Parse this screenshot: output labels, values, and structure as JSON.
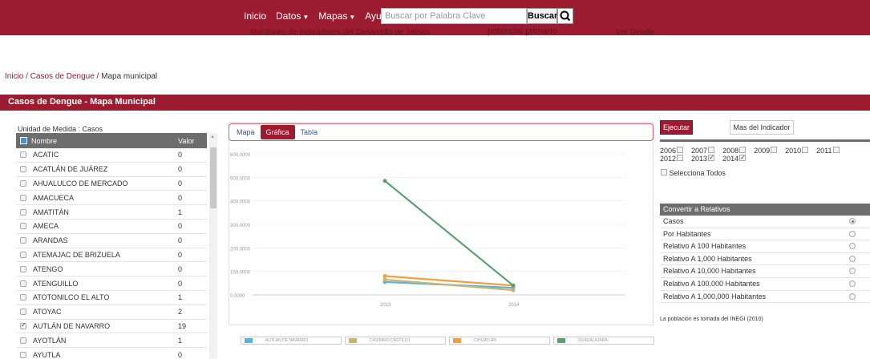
{
  "nav": {
    "inicio": "Inicio",
    "datos": "Datos",
    "mapas": "Mapas",
    "ayuda": "Ayuda",
    "search_placeholder": "Buscar por Palabra Clave",
    "buscar": "Buscar",
    "ghost_left": "Monitoreo de Indicadores del Desarrollo de Jalisco",
    "ghost_mid": "potencial primario",
    "ghost_right": "Ver Detalle"
  },
  "breadcrumb": {
    "home": "Inicio",
    "sep": " / ",
    "section": "Casos de Dengue",
    "current": "Mapa municipal"
  },
  "section_title": "Casos de Dengue - Mapa Municipal",
  "table": {
    "unit_label": "Unidad de Medida : Casos",
    "col_name": "Nombre",
    "col_value": "Valor",
    "rows": [
      {
        "name": "ACATIC",
        "value": "0",
        "checked": false
      },
      {
        "name": "ACATLÁN DE JUÁREZ",
        "value": "0",
        "checked": false
      },
      {
        "name": "AHUALULCO DE MERCADO",
        "value": "0",
        "checked": false
      },
      {
        "name": "AMACUECA",
        "value": "0",
        "checked": false
      },
      {
        "name": "AMATITÁN",
        "value": "1",
        "checked": false
      },
      {
        "name": "AMECA",
        "value": "0",
        "checked": false
      },
      {
        "name": "ARANDAS",
        "value": "0",
        "checked": false
      },
      {
        "name": "ATEMAJAC DE BRIZUELA",
        "value": "0",
        "checked": false
      },
      {
        "name": "ATENGO",
        "value": "0",
        "checked": false
      },
      {
        "name": "ATENGUILLO",
        "value": "0",
        "checked": false
      },
      {
        "name": "ATOTONILCO EL ALTO",
        "value": "1",
        "checked": false
      },
      {
        "name": "ATOYAC",
        "value": "2",
        "checked": false
      },
      {
        "name": "AUTLÁN DE NAVARRO",
        "value": "19",
        "checked": true
      },
      {
        "name": "AYOTLÁN",
        "value": "1",
        "checked": false
      },
      {
        "name": "AYUTLA",
        "value": "0",
        "checked": false
      }
    ]
  },
  "tabs": {
    "mapa": "Mapa",
    "grafica": "Gráfica",
    "tabla": "Tabla"
  },
  "chart_data": {
    "type": "line",
    "x": [
      "2013",
      "2014"
    ],
    "ylim": [
      0,
      600
    ],
    "yticks": [
      "0.0000",
      "100.0000",
      "200.0000",
      "300.0000",
      "400.0000",
      "500.0000",
      "600.0000"
    ],
    "series": [
      {
        "name": "AUTLÁN DE NAVARRO",
        "color": "#5ab4d6",
        "values": [
          55,
          30
        ]
      },
      {
        "name": "CASIMIRO CASTILLO",
        "color": "#c9b27a",
        "values": [
          65,
          20
        ]
      },
      {
        "name": "CIHUATLÁN",
        "color": "#f0a040",
        "values": [
          80,
          40
        ]
      },
      {
        "name": "GUADALAJARA",
        "color": "#5aa070",
        "values": [
          485,
          40
        ]
      }
    ]
  },
  "right": {
    "ejecutar": "Ejecutar",
    "mas": "Mas del Indicador",
    "years": [
      {
        "label": "2006",
        "checked": false
      },
      {
        "label": "2007",
        "checked": false
      },
      {
        "label": "2008",
        "checked": false
      },
      {
        "label": "2009",
        "checked": false
      },
      {
        "label": "2010",
        "checked": false
      },
      {
        "label": "2011",
        "checked": false
      },
      {
        "label": "2012",
        "checked": false
      },
      {
        "label": "2013",
        "checked": true
      },
      {
        "label": "2014",
        "checked": true
      }
    ],
    "select_all": "Selecciona Todos",
    "convert_title": "Convertir a Relativos",
    "options": [
      {
        "label": "Casos",
        "selected": true
      },
      {
        "label": "Por Habitantes",
        "selected": false
      },
      {
        "label": "Relativo A 100 Habitantes",
        "selected": false
      },
      {
        "label": "Relativo A 1,000 Habitantes",
        "selected": false
      },
      {
        "label": "Relativo A 10,000 Habitantes",
        "selected": false
      },
      {
        "label": "Relativo A 100,000 Habitantes",
        "selected": false
      },
      {
        "label": "Relativo A 1,000,000 Habitantes",
        "selected": false
      }
    ],
    "note": "La población es tomada del INEGI (2010)"
  }
}
